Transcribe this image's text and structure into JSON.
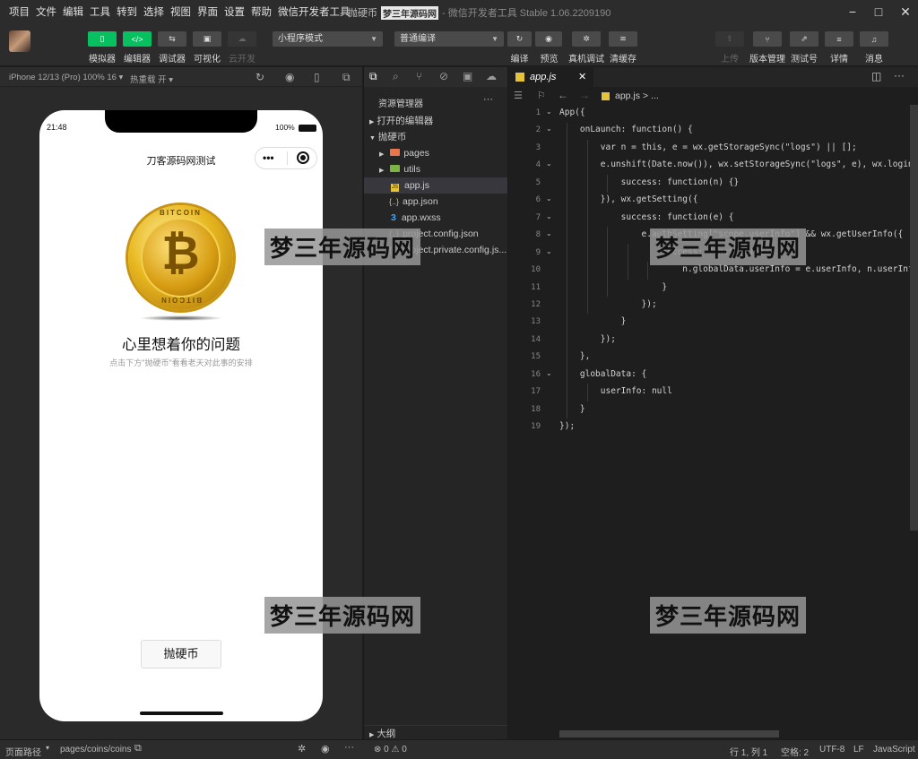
{
  "menubar": {
    "items": [
      "项目",
      "文件",
      "编辑",
      "工具",
      "转到",
      "选择",
      "视图",
      "界面",
      "设置",
      "帮助",
      "微信开发者工具"
    ],
    "title_project": "抛硬币",
    "title_watermark": "梦三年源码网",
    "title_app": "- 微信开发者工具 Stable 1.06.2209190"
  },
  "toolbar": {
    "left_buttons": [
      {
        "label": "模拟器",
        "icon": "phone-icon",
        "glyph": "▯"
      },
      {
        "label": "编辑器",
        "icon": "code-icon",
        "glyph": "</>"
      },
      {
        "label": "调试器",
        "icon": "debug-icon",
        "glyph": "⇆"
      },
      {
        "label": "可视化",
        "icon": "layout-icon",
        "glyph": "▣"
      },
      {
        "label": "云开发",
        "icon": "cloud-icon",
        "glyph": "☁"
      }
    ],
    "mode_select": "小程序模式",
    "compile_select": "普通编译",
    "mid_buttons": [
      {
        "label": "编译",
        "icon": "refresh-icon",
        "glyph": "↻"
      },
      {
        "label": "预览",
        "icon": "eye-icon",
        "glyph": "◉"
      },
      {
        "label": "真机调试",
        "icon": "bug-icon",
        "glyph": "✲"
      },
      {
        "label": "清缓存",
        "icon": "layers-icon",
        "glyph": "≋"
      }
    ],
    "right_buttons": [
      {
        "label": "上传",
        "icon": "upload-icon",
        "glyph": "⇧"
      },
      {
        "label": "版本管理",
        "icon": "branch-icon",
        "glyph": "⑂"
      },
      {
        "label": "测试号",
        "icon": "external-icon",
        "glyph": "⇗"
      },
      {
        "label": "详情",
        "icon": "menu-icon",
        "glyph": "≡"
      },
      {
        "label": "消息",
        "icon": "bell-icon",
        "glyph": "♫"
      }
    ]
  },
  "simulator": {
    "device": "iPhone 12/13 (Pro) 100% 16 ▾",
    "hot_reload": "热重载 开 ▾",
    "time": "21:48",
    "battery": "100%",
    "nav_title": "刀客源码网测试",
    "coin_text_top": "BITCOIN",
    "coin_text_bottom": "BITCOIN",
    "coin_symbol": "₿",
    "heading": "心里想着你的问题",
    "subtitle": "点击下方\"抛硬币\"看看老天对此事的安排",
    "button": "抛硬币"
  },
  "explorer": {
    "title": "资源管理器",
    "more": "···",
    "open_editors": "打开的编辑器",
    "project": "抛硬币",
    "items": [
      {
        "name": "pages",
        "type": "folder",
        "color": "#e8764a"
      },
      {
        "name": "utils",
        "type": "folder",
        "color": "#7cb342"
      },
      {
        "name": "app.js",
        "type": "js"
      },
      {
        "name": "app.json",
        "type": "json"
      },
      {
        "name": "app.wxss",
        "type": "wxss"
      },
      {
        "name": "project.config.json",
        "type": "json"
      },
      {
        "name": "project.private.config.js...",
        "type": "json"
      }
    ],
    "outline": "大纲",
    "problems": "⊗ 0 ⚠ 0"
  },
  "editor": {
    "tab": "app.js",
    "breadcrumb": "app.js > ...",
    "lines": [
      "App({",
      "    onLaunch: function() {",
      "        var n = this, e = wx.getStorageSync(\"logs\") || [];",
      "        e.unshift(Date.now()), wx.setStorageSync(\"logs\", e), wx.login({",
      "            success: function(n) {}",
      "        }), wx.getSetting({",
      "            success: function(e) {",
      "                e.authSetting[\"scope.userInfo\"] && wx.getUserInfo({",
      "                    success: function(e) {",
      "                        n.globalData.userInfo = e.userInfo, n.userInfoReady",
      "                    }",
      "                });",
      "            }",
      "        });",
      "    },",
      "    globalData: {",
      "        userInfo: null",
      "    }",
      "});"
    ]
  },
  "status": {
    "path_label": "页面路径",
    "path": "pages/coins/coins",
    "cursor": "行 1, 列 1",
    "spaces": "空格: 2",
    "encoding": "UTF-8",
    "eol": "LF",
    "language": "JavaScript"
  },
  "watermark": "梦三年源码网"
}
